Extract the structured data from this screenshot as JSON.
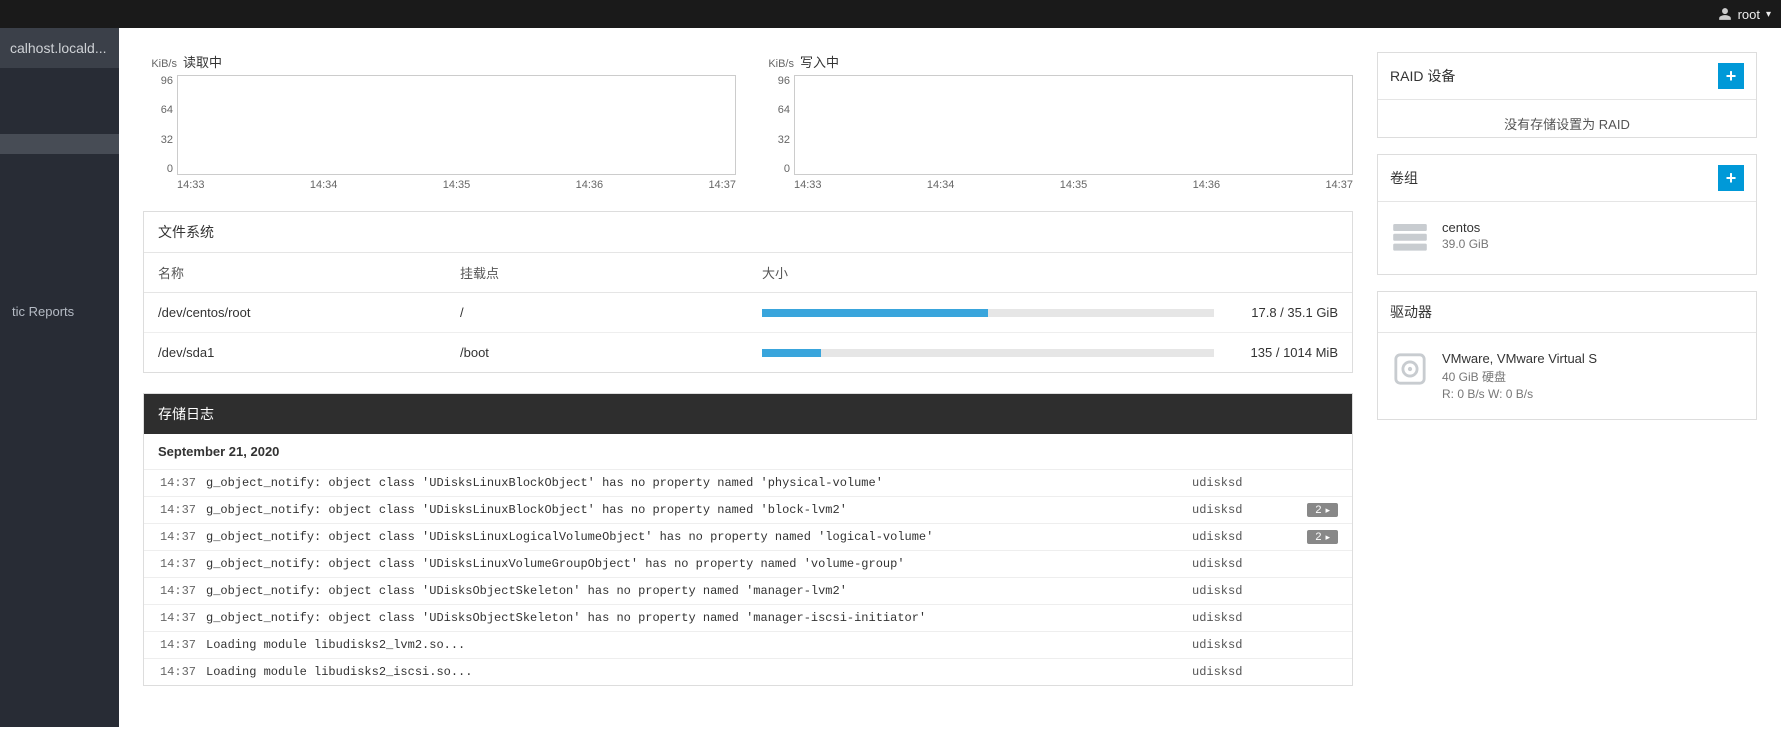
{
  "topbar": {
    "user": "root"
  },
  "sidebar": {
    "host": "calhost.locald...",
    "items": [
      {
        "label": ""
      },
      {
        "label": ""
      },
      {
        "label": ""
      },
      {
        "label": "",
        "active": true
      },
      {
        "label": ""
      },
      {
        "label": ""
      },
      {
        "label": ""
      },
      {
        "label": ""
      },
      {
        "label": ""
      },
      {
        "label": ""
      },
      {
        "label": ""
      },
      {
        "label": "tic Reports"
      }
    ]
  },
  "chart_data": [
    {
      "type": "line",
      "title": "读取中",
      "unit": "KiB/s",
      "categories": [
        "14:33",
        "14:34",
        "14:35",
        "14:36",
        "14:37"
      ],
      "values": [
        0,
        0,
        0,
        0,
        0
      ],
      "yticks": [
        96,
        64,
        32,
        0
      ],
      "ylim": [
        0,
        96
      ]
    },
    {
      "type": "line",
      "title": "写入中",
      "unit": "KiB/s",
      "categories": [
        "14:33",
        "14:34",
        "14:35",
        "14:36",
        "14:37"
      ],
      "values": [
        0,
        0,
        0,
        0,
        0
      ],
      "yticks": [
        96,
        64,
        32,
        0
      ],
      "ylim": [
        0,
        96
      ]
    }
  ],
  "filesystems": {
    "title": "文件系统",
    "cols": {
      "name": "名称",
      "mount": "挂载点",
      "size": "大小"
    },
    "rows": [
      {
        "name": "/dev/centos/root",
        "mount": "/",
        "used_pct": 50,
        "size_text": "17.8 / 35.1 GiB"
      },
      {
        "name": "/dev/sda1",
        "mount": "/boot",
        "used_pct": 13,
        "size_text": "135 / 1014 MiB"
      }
    ]
  },
  "logs": {
    "title": "存储日志",
    "date": "September 21, 2020",
    "entries": [
      {
        "time": "14:37",
        "msg": "g_object_notify: object class 'UDisksLinuxBlockObject' has no property named 'physical-volume'",
        "svc": "udisksd",
        "count": null
      },
      {
        "time": "14:37",
        "msg": "g_object_notify: object class 'UDisksLinuxBlockObject' has no property named 'block-lvm2'",
        "svc": "udisksd",
        "count": 2
      },
      {
        "time": "14:37",
        "msg": "g_object_notify: object class 'UDisksLinuxLogicalVolumeObject' has no property named 'logical-volume'",
        "svc": "udisksd",
        "count": 2
      },
      {
        "time": "14:37",
        "msg": "g_object_notify: object class 'UDisksLinuxVolumeGroupObject' has no property named 'volume-group'",
        "svc": "udisksd",
        "count": null
      },
      {
        "time": "14:37",
        "msg": "g_object_notify: object class 'UDisksObjectSkeleton' has no property named 'manager-lvm2'",
        "svc": "udisksd",
        "count": null
      },
      {
        "time": "14:37",
        "msg": "g_object_notify: object class 'UDisksObjectSkeleton' has no property named 'manager-iscsi-initiator'",
        "svc": "udisksd",
        "count": null
      },
      {
        "time": "14:37",
        "msg": "Loading module libudisks2_lvm2.so...",
        "svc": "udisksd",
        "count": null
      },
      {
        "time": "14:37",
        "msg": "Loading module libudisks2_iscsi.so...",
        "svc": "udisksd",
        "count": null
      }
    ]
  },
  "raid": {
    "title": "RAID 设备",
    "empty": "没有存储设置为 RAID"
  },
  "vg": {
    "title": "卷组",
    "item": {
      "name": "centos",
      "size": "39.0 GiB"
    }
  },
  "drives": {
    "title": "驱动器",
    "item": {
      "name": "VMware, VMware Virtual S",
      "size": "40 GiB 硬盘",
      "rw": "R: 0 B/s     W: 0 B/s"
    }
  }
}
